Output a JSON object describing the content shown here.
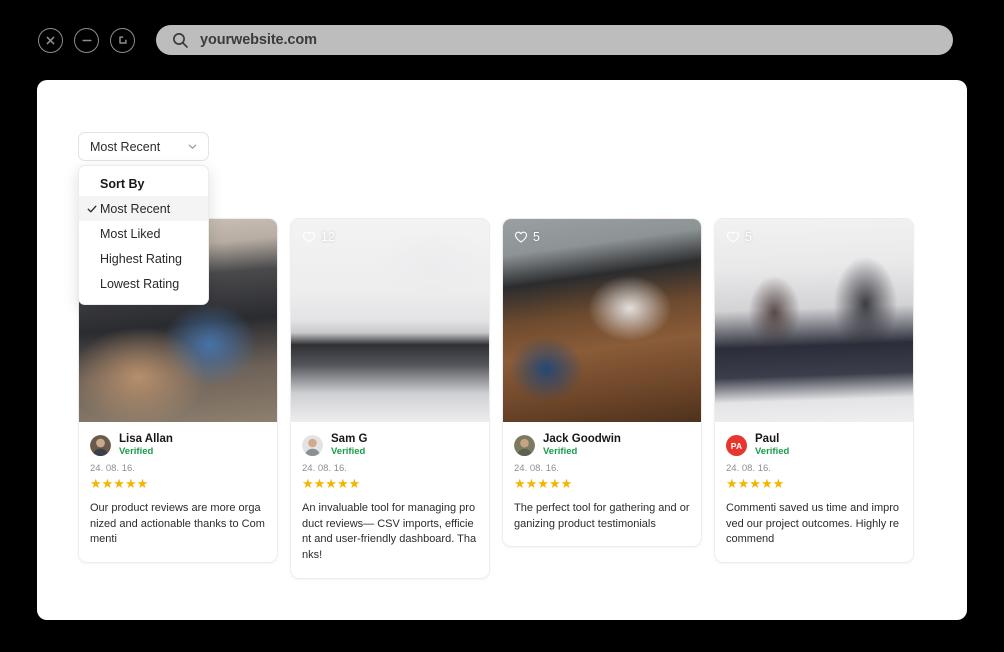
{
  "browser": {
    "close_icon": "close-icon",
    "minimize_icon": "minimize-icon",
    "maximize_icon": "maximize-icon",
    "search_icon": "search-icon",
    "url": "yourwebsite.com"
  },
  "sort": {
    "selected": "Most Recent",
    "chevron_icon": "chevron-down-icon",
    "dropdown": {
      "title": "Sort By",
      "check_icon": "check-icon",
      "options": [
        {
          "label": "Most Recent",
          "selected": true
        },
        {
          "label": "Most Liked",
          "selected": false
        },
        {
          "label": "Highest Rating",
          "selected": false
        },
        {
          "label": "Lowest Rating",
          "selected": false
        }
      ]
    }
  },
  "reviews": [
    {
      "name": "Lisa Allan",
      "verified": "Verified",
      "date": "24. 08. 16.",
      "stars": "★★★★★",
      "rating": 5,
      "text": "Our product reviews are more organized and actionable thanks to Commenti",
      "likes": "",
      "like_icon": "heart-icon",
      "avatar_type": "photo",
      "avatar_initials": ""
    },
    {
      "name": "Sam G",
      "verified": "Verified",
      "date": "24. 08. 16.",
      "stars": "★★★★★",
      "rating": 5,
      "text": "An invaluable tool for managing product reviews— CSV imports, efficient and user-friendly dashboard. Thanks!",
      "likes": "12",
      "like_icon": "heart-icon",
      "avatar_type": "photo",
      "avatar_initials": ""
    },
    {
      "name": "Jack Goodwin",
      "verified": "Verified",
      "date": "24. 08. 16.",
      "stars": "★★★★★",
      "rating": 5,
      "text": "The perfect tool for gathering and organizing product testimonials",
      "likes": "5",
      "like_icon": "heart-icon",
      "avatar_type": "photo",
      "avatar_initials": ""
    },
    {
      "name": "Paul",
      "verified": "Verified",
      "date": "24. 08. 16.",
      "stars": "★★★★★",
      "rating": 5,
      "text": "Commenti saved us time and improved our project outcomes. Highly recommend",
      "likes": "5",
      "like_icon": "heart-icon",
      "avatar_type": "initials",
      "avatar_initials": "PA"
    }
  ],
  "colors": {
    "frame": "#000000",
    "page": "#ffffff",
    "url_bar": "#bdbdbd",
    "verified_green": "#1a9c4a",
    "star_gold": "#f5b400",
    "avatar_red": "#e8352e",
    "dropdown_highlight": "#f4f4f5"
  }
}
